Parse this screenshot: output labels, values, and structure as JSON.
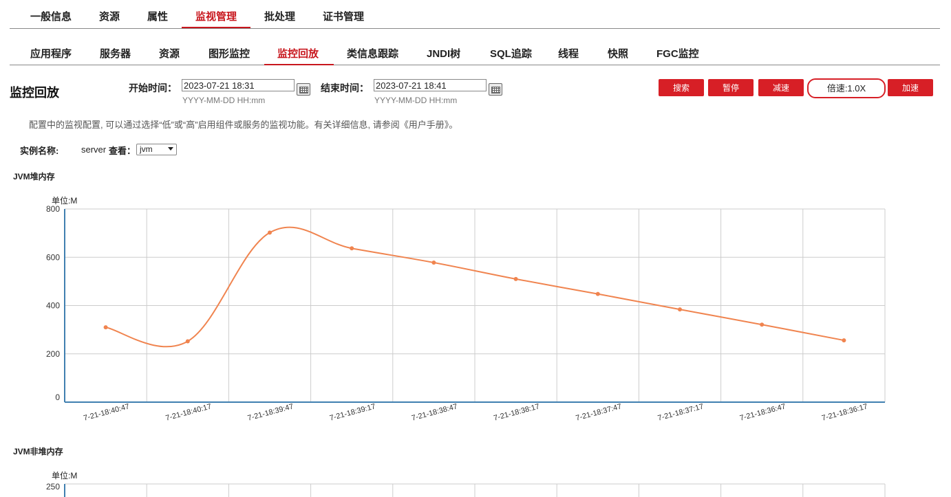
{
  "top_tabs": [
    "一般信息",
    "资源",
    "属性",
    "监视管理",
    "批处理",
    "证书管理"
  ],
  "top_active": "监视管理",
  "sub_tabs": [
    "应用程序",
    "服务器",
    "资源",
    "图形监控",
    "监控回放",
    "类信息跟踪",
    "JNDI树",
    "SQL追踪",
    "线程",
    "快照",
    "FGC监控"
  ],
  "sub_active": "监控回放",
  "page_title": "监控回放",
  "time_filter": {
    "start_label": "开始时间：",
    "start_value": "2023-07-21 18:31",
    "end_label": "结束时间：",
    "end_value": "2023-07-21 18:41",
    "format_hint": "YYYY-MM-DD HH:mm"
  },
  "controls": {
    "search": "搜索",
    "pause": "暂停",
    "slow_down": "减速",
    "speed": "倍速:1.0X",
    "speed_up": "加速"
  },
  "description": "配置中的监视配置, 可以通过选择“低”或“高”启用组件或服务的监视功能。有关详细信息, 请参阅《用户手册》。",
  "instance": {
    "label": "实例名称:",
    "server": "server",
    "view_label": "查看：",
    "view_value": "jvm"
  },
  "accent_color": "#d71f26",
  "icons": {
    "calendar": "calendar-icon",
    "dropdown": "chevron-down-icon"
  },
  "chart_data": [
    {
      "type": "line",
      "title": "JVM堆内存",
      "ylabel": "单位:M",
      "x": [
        "7-21-18:40:47",
        "7-21-18:40:17",
        "7-21-18:39:47",
        "7-21-18:39:17",
        "7-21-18:38:47",
        "7-21-18:38:17",
        "7-21-18:37:47",
        "7-21-18:37:17",
        "7-21-18:36:47",
        "7-21-18:36:17"
      ],
      "series": [
        {
          "values": [
            310,
            252,
            702,
            637,
            578,
            510,
            448,
            384,
            321,
            256
          ],
          "color": "#f0844f"
        }
      ],
      "ylim": [
        0,
        800
      ],
      "yticks": [
        0,
        200,
        400,
        600,
        800
      ],
      "grid": true,
      "smooth": true
    },
    {
      "type": "line",
      "title": "JVM非堆内存",
      "ylabel": "单位:M",
      "yticks": [
        250
      ],
      "grid": true
    }
  ]
}
